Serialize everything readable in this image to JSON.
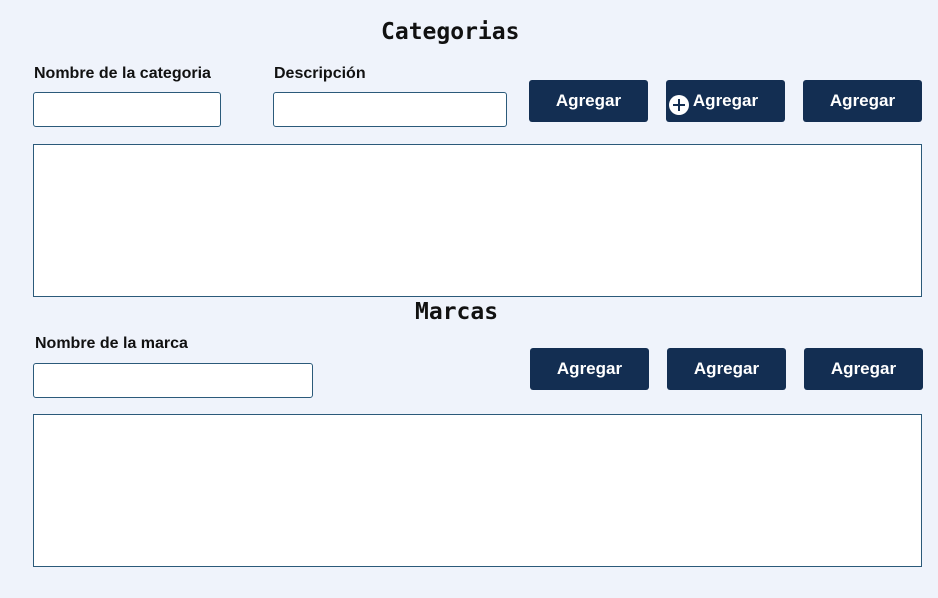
{
  "categorias": {
    "title": "Categorias",
    "name_label": "Nombre de la categoria",
    "name_value": "",
    "description_label": "Descripción",
    "description_value": "",
    "buttons": [
      "Agregar",
      "Agregar",
      "Agregar"
    ]
  },
  "marcas": {
    "title": "Marcas",
    "name_label": "Nombre de la marca",
    "name_value": "",
    "buttons": [
      "Agregar",
      "Agregar",
      "Agregar"
    ]
  },
  "icons": {
    "cursor_icon": "plus-circle-icon"
  },
  "colors": {
    "background": "#eff3fb",
    "button": "#132e52",
    "border": "#2b5a7a"
  }
}
